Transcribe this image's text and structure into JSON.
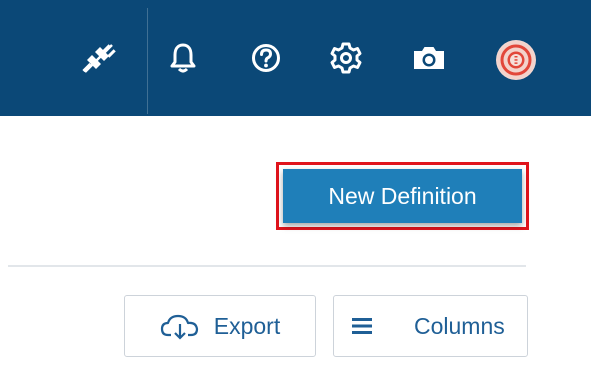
{
  "topbar": {
    "background": "#0b4877",
    "icons": [
      {
        "name": "plug-disconnected-icon"
      },
      {
        "name": "bell-icon"
      },
      {
        "name": "help-icon"
      },
      {
        "name": "gear-icon"
      },
      {
        "name": "camera-icon"
      }
    ],
    "avatar": {
      "name": "user-avatar",
      "color": "#e2473a"
    }
  },
  "main": {
    "new_definition_label": "New Definition",
    "accent": "#1f7fb9",
    "highlight_border": "#e0141c",
    "toolbar": {
      "export_label": "Export",
      "columns_label": "Columns"
    }
  }
}
